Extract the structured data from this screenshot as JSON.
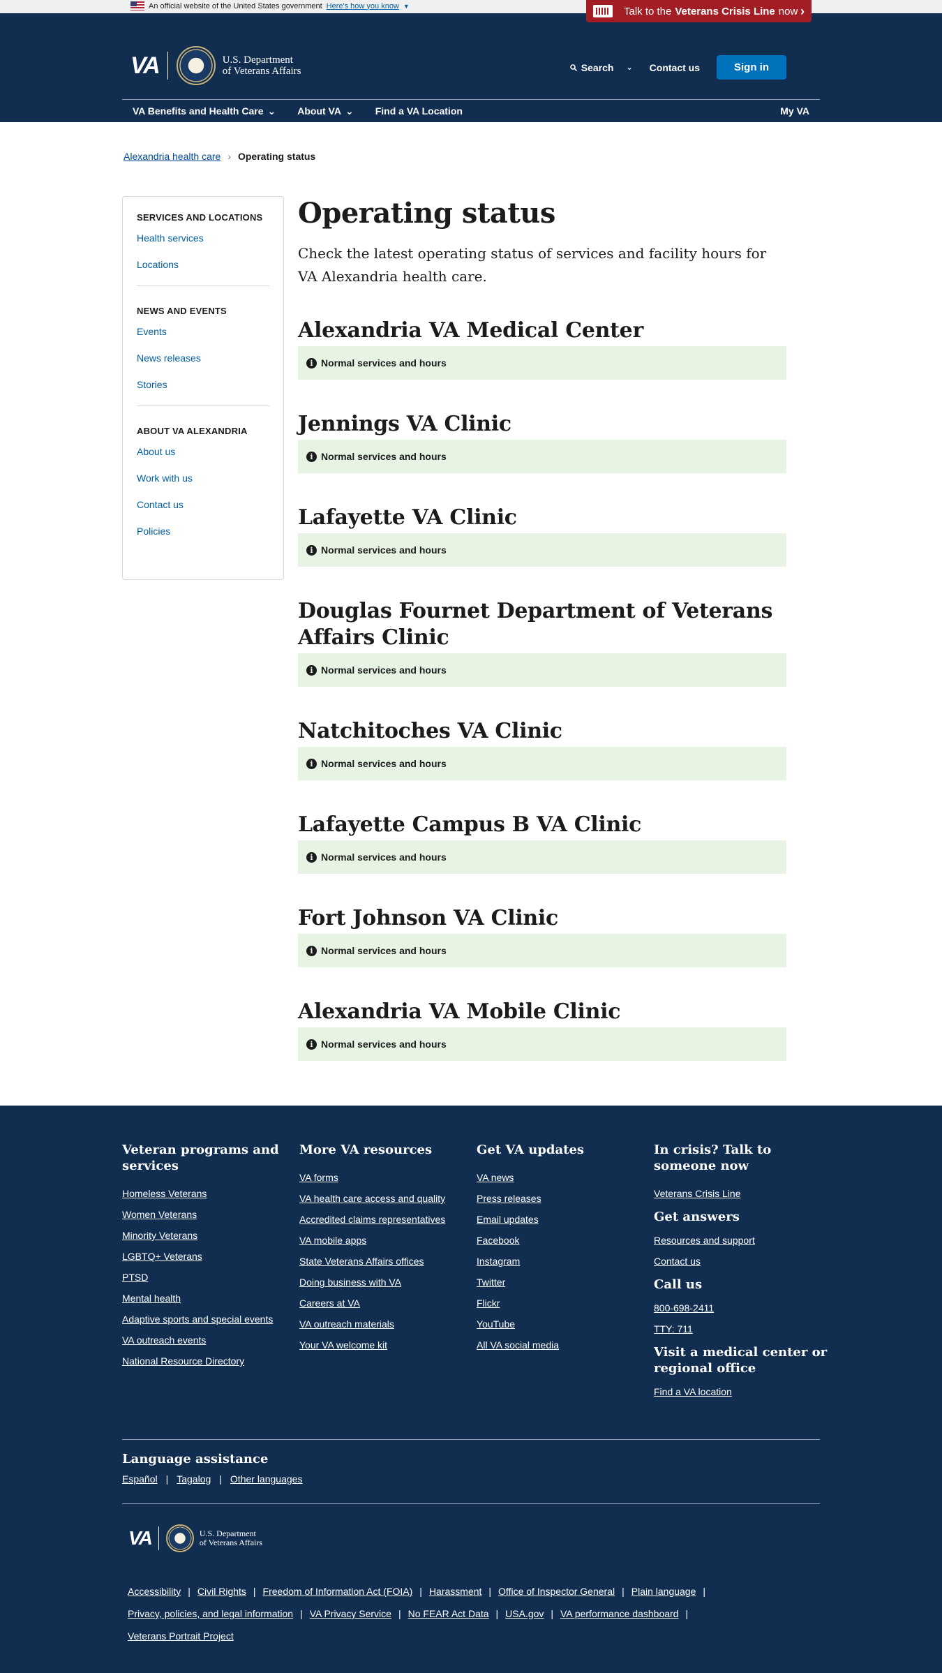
{
  "banner": {
    "text": "An official website of the United States government",
    "how_link": "Here's how you know"
  },
  "crisis": {
    "prefix": "Talk to the",
    "bold": "Veterans Crisis Line",
    "suffix": "now"
  },
  "header": {
    "logo_text": "VA",
    "dept_line1": "U.S. Department",
    "dept_line2": "of Veterans Affairs",
    "search": "Search",
    "contact": "Contact us",
    "signin": "Sign in",
    "nav": [
      "VA Benefits and Health Care",
      "About VA",
      "Find a VA Location"
    ],
    "myva": "My VA"
  },
  "breadcrumb": {
    "parent": "Alexandria health care",
    "current": "Operating status"
  },
  "sidebar": {
    "sections": [
      {
        "title": "SERVICES AND LOCATIONS",
        "links": [
          "Health services",
          "Locations"
        ]
      },
      {
        "title": "NEWS AND EVENTS",
        "links": [
          "Events",
          "News releases",
          "Stories"
        ]
      },
      {
        "title": "ABOUT VA ALEXANDRIA",
        "links": [
          "About us",
          "Work with us",
          "Contact us",
          "Policies"
        ]
      }
    ]
  },
  "main": {
    "title": "Operating status",
    "intro": "Check the latest operating status of services and facility hours for VA Alexandria health care.",
    "status_text": "Normal services and hours",
    "facilities": [
      "Alexandria VA Medical Center",
      "Jennings VA Clinic",
      "Lafayette VA Clinic",
      "Douglas Fournet Department of Veterans Affairs Clinic",
      "Natchitoches VA Clinic",
      "Lafayette Campus B VA Clinic",
      "Fort Johnson VA Clinic",
      "Alexandria VA Mobile Clinic"
    ]
  },
  "footer": {
    "col1": {
      "title": "Veteran programs and services",
      "links": [
        "Homeless Veterans",
        "Women Veterans",
        "Minority Veterans",
        "LGBTQ+ Veterans",
        "PTSD",
        "Mental health",
        "Adaptive sports and special events",
        "VA outreach events",
        "National Resource Directory"
      ]
    },
    "col2": {
      "title": "More VA resources",
      "links": [
        "VA forms",
        "VA health care access and quality",
        "Accredited claims representatives",
        "VA mobile apps",
        "State Veterans Affairs offices",
        "Doing business with VA",
        "Careers at VA",
        "VA outreach materials",
        "Your VA welcome kit"
      ]
    },
    "col3": {
      "title": "Get VA updates",
      "links": [
        "VA news",
        "Press releases",
        "Email updates",
        "Facebook",
        "Instagram",
        "Twitter",
        "Flickr",
        "YouTube",
        "All VA social media"
      ]
    },
    "col4": {
      "crisis_title": "In crisis? Talk to someone now",
      "crisis_link": "Veterans Crisis Line",
      "answers_title": "Get answers",
      "answers_links": [
        "Resources and support",
        "Contact us"
      ],
      "call_title": "Call us",
      "call_links": [
        "800-698-2411",
        "TTY: 711"
      ],
      "visit_title": "Visit a medical center or regional office",
      "visit_link": "Find a VA location"
    },
    "language": {
      "title": "Language assistance",
      "links": [
        "Español",
        "Tagalog",
        "Other languages"
      ]
    },
    "bottom_links": [
      "Accessibility",
      "Civil Rights",
      "Freedom of Information Act (FOIA)",
      "Harassment",
      "Office of Inspector General",
      "Plain language",
      "Privacy, policies, and legal information",
      "VA Privacy Service",
      "No FEAR Act Data",
      "USA.gov",
      "VA performance dashboard",
      "Veterans Portrait Project"
    ]
  }
}
